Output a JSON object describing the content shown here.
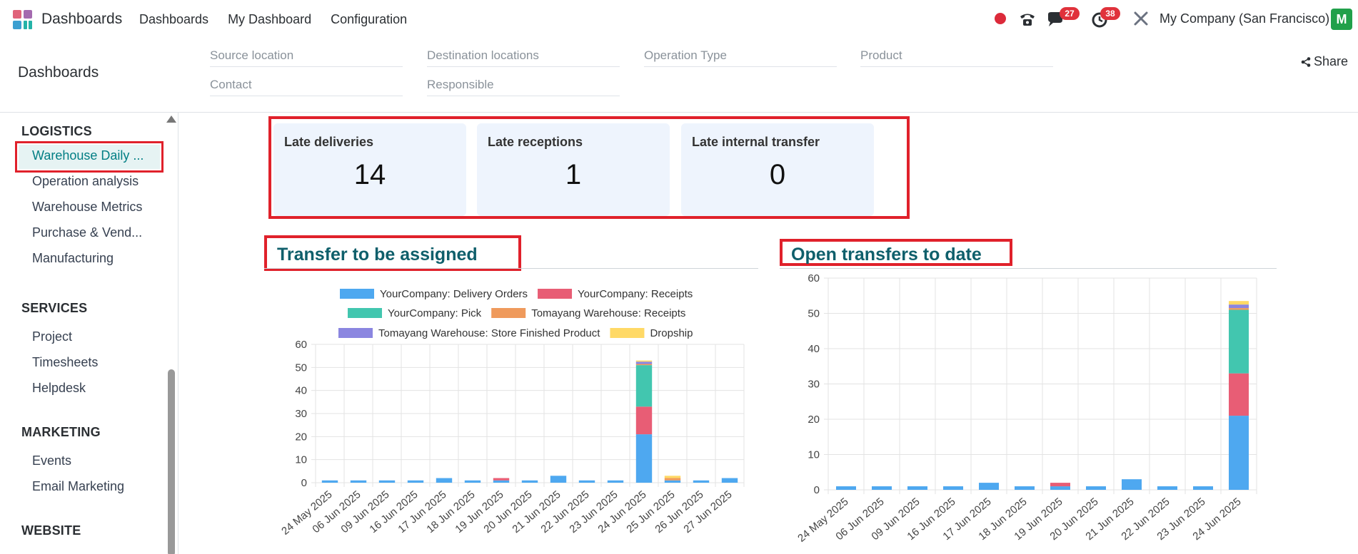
{
  "navbar": {
    "app_name": "Dashboards",
    "menu": [
      "Dashboards",
      "My Dashboard",
      "Configuration"
    ],
    "messages_badge": "27",
    "activities_badge": "38",
    "company": "My Company (San Francisco)",
    "avatar_initial": "M"
  },
  "control_panel": {
    "breadcrumb": "Dashboards",
    "filters": [
      "Source location",
      "Destination locations",
      "Operation Type",
      "Product",
      "Contact",
      "Responsible"
    ],
    "share_label": "Share"
  },
  "sidebar": {
    "sections": [
      {
        "title": "LOGISTICS",
        "items": [
          "Warehouse Daily ...",
          "Operation analysis",
          "Warehouse Metrics",
          "Purchase & Vend...",
          "Manufacturing"
        ]
      },
      {
        "title": "SERVICES",
        "items": [
          "Project",
          "Timesheets",
          "Helpdesk"
        ]
      },
      {
        "title": "MARKETING",
        "items": [
          "Events",
          "Email Marketing"
        ]
      },
      {
        "title": "WEBSITE",
        "items": []
      }
    ],
    "active_item": "Warehouse Daily ..."
  },
  "kpis": [
    {
      "label": "Late deliveries",
      "value": "14"
    },
    {
      "label": "Late receptions",
      "value": "1"
    },
    {
      "label": "Late internal transfer",
      "value": "0"
    }
  ],
  "colors": {
    "accent": "#017e84",
    "highlight_red": "#e0212b",
    "series": [
      "#4ea8f0",
      "#e85d75",
      "#42c6af",
      "#ef9a5c",
      "#8b86e0",
      "#ffd966"
    ]
  },
  "chart_data": [
    {
      "type": "bar",
      "stacked": true,
      "title": "Transfer to be assigned",
      "legend_position": "top",
      "grid": true,
      "ylim": [
        0,
        60
      ],
      "yticks": [
        0,
        10,
        20,
        30,
        40,
        50,
        60
      ],
      "categories": [
        "24 May 2025",
        "06 Jun 2025",
        "09 Jun 2025",
        "16 Jun 2025",
        "17 Jun 2025",
        "18 Jun 2025",
        "19 Jun 2025",
        "20 Jun 2025",
        "21 Jun 2025",
        "22 Jun 2025",
        "23 Jun 2025",
        "24 Jun 2025",
        "25 Jun 2025",
        "26 Jun 2025",
        "27 Jun 2025"
      ],
      "series": [
        {
          "name": "YourCompany: Delivery Orders",
          "color": "#4ea8f0",
          "values": [
            1,
            1,
            1,
            1,
            2,
            1,
            1,
            1,
            3,
            1,
            1,
            21,
            1,
            1,
            2
          ]
        },
        {
          "name": "YourCompany: Receipts",
          "color": "#e85d75",
          "values": [
            0,
            0,
            0,
            0,
            0,
            0,
            1,
            0,
            0,
            0,
            0,
            12,
            0,
            0,
            0
          ]
        },
        {
          "name": "YourCompany: Pick",
          "color": "#42c6af",
          "values": [
            0,
            0,
            0,
            0,
            0,
            0,
            0,
            0,
            0,
            0,
            0,
            18,
            0,
            0,
            0
          ]
        },
        {
          "name": "Tomayang Warehouse: Receipts",
          "color": "#ef9a5c",
          "values": [
            0,
            0,
            0,
            0,
            0,
            0,
            0,
            0,
            0,
            0,
            0,
            0.5,
            1,
            0,
            0
          ]
        },
        {
          "name": "Tomayang Warehouse: Store Finished Product",
          "color": "#8b86e0",
          "values": [
            0,
            0,
            0,
            0,
            0,
            0,
            0,
            0,
            0,
            0,
            0,
            1,
            0,
            0,
            0
          ]
        },
        {
          "name": "Dropship",
          "color": "#ffd966",
          "values": [
            0,
            0,
            0,
            0,
            0,
            0,
            0,
            0,
            0,
            0,
            0,
            0.5,
            1,
            0,
            0
          ]
        }
      ]
    },
    {
      "type": "bar",
      "stacked": true,
      "title": "Open transfers to date",
      "grid": true,
      "ylim": [
        0,
        60
      ],
      "yticks": [
        0,
        10,
        20,
        30,
        40,
        50,
        60
      ],
      "categories": [
        "24 May 2025",
        "06 Jun 2025",
        "09 Jun 2025",
        "16 Jun 2025",
        "17 Jun 2025",
        "18 Jun 2025",
        "19 Jun 2025",
        "20 Jun 2025",
        "21 Jun 2025",
        "22 Jun 2025",
        "23 Jun 2025",
        "24 Jun 2025"
      ],
      "series": [
        {
          "color": "#4ea8f0",
          "values": [
            1,
            1,
            1,
            1,
            2,
            1,
            1,
            1,
            3,
            1,
            1,
            21
          ]
        },
        {
          "color": "#e85d75",
          "values": [
            0,
            0,
            0,
            0,
            0,
            0,
            1,
            0,
            0,
            0,
            0,
            12
          ]
        },
        {
          "color": "#42c6af",
          "values": [
            0,
            0,
            0,
            0,
            0,
            0,
            0,
            0,
            0,
            0,
            0,
            18
          ]
        },
        {
          "color": "#ef9a5c",
          "values": [
            0,
            0,
            0,
            0,
            0,
            0,
            0,
            0,
            0,
            0,
            0,
            0.5
          ]
        },
        {
          "color": "#8b86e0",
          "values": [
            0,
            0,
            0,
            0,
            0,
            0,
            0,
            0,
            0,
            0,
            0,
            1
          ]
        },
        {
          "color": "#ffd966",
          "values": [
            0,
            0,
            0,
            0,
            0,
            0,
            0,
            0,
            0,
            0,
            0,
            1
          ]
        }
      ]
    }
  ]
}
